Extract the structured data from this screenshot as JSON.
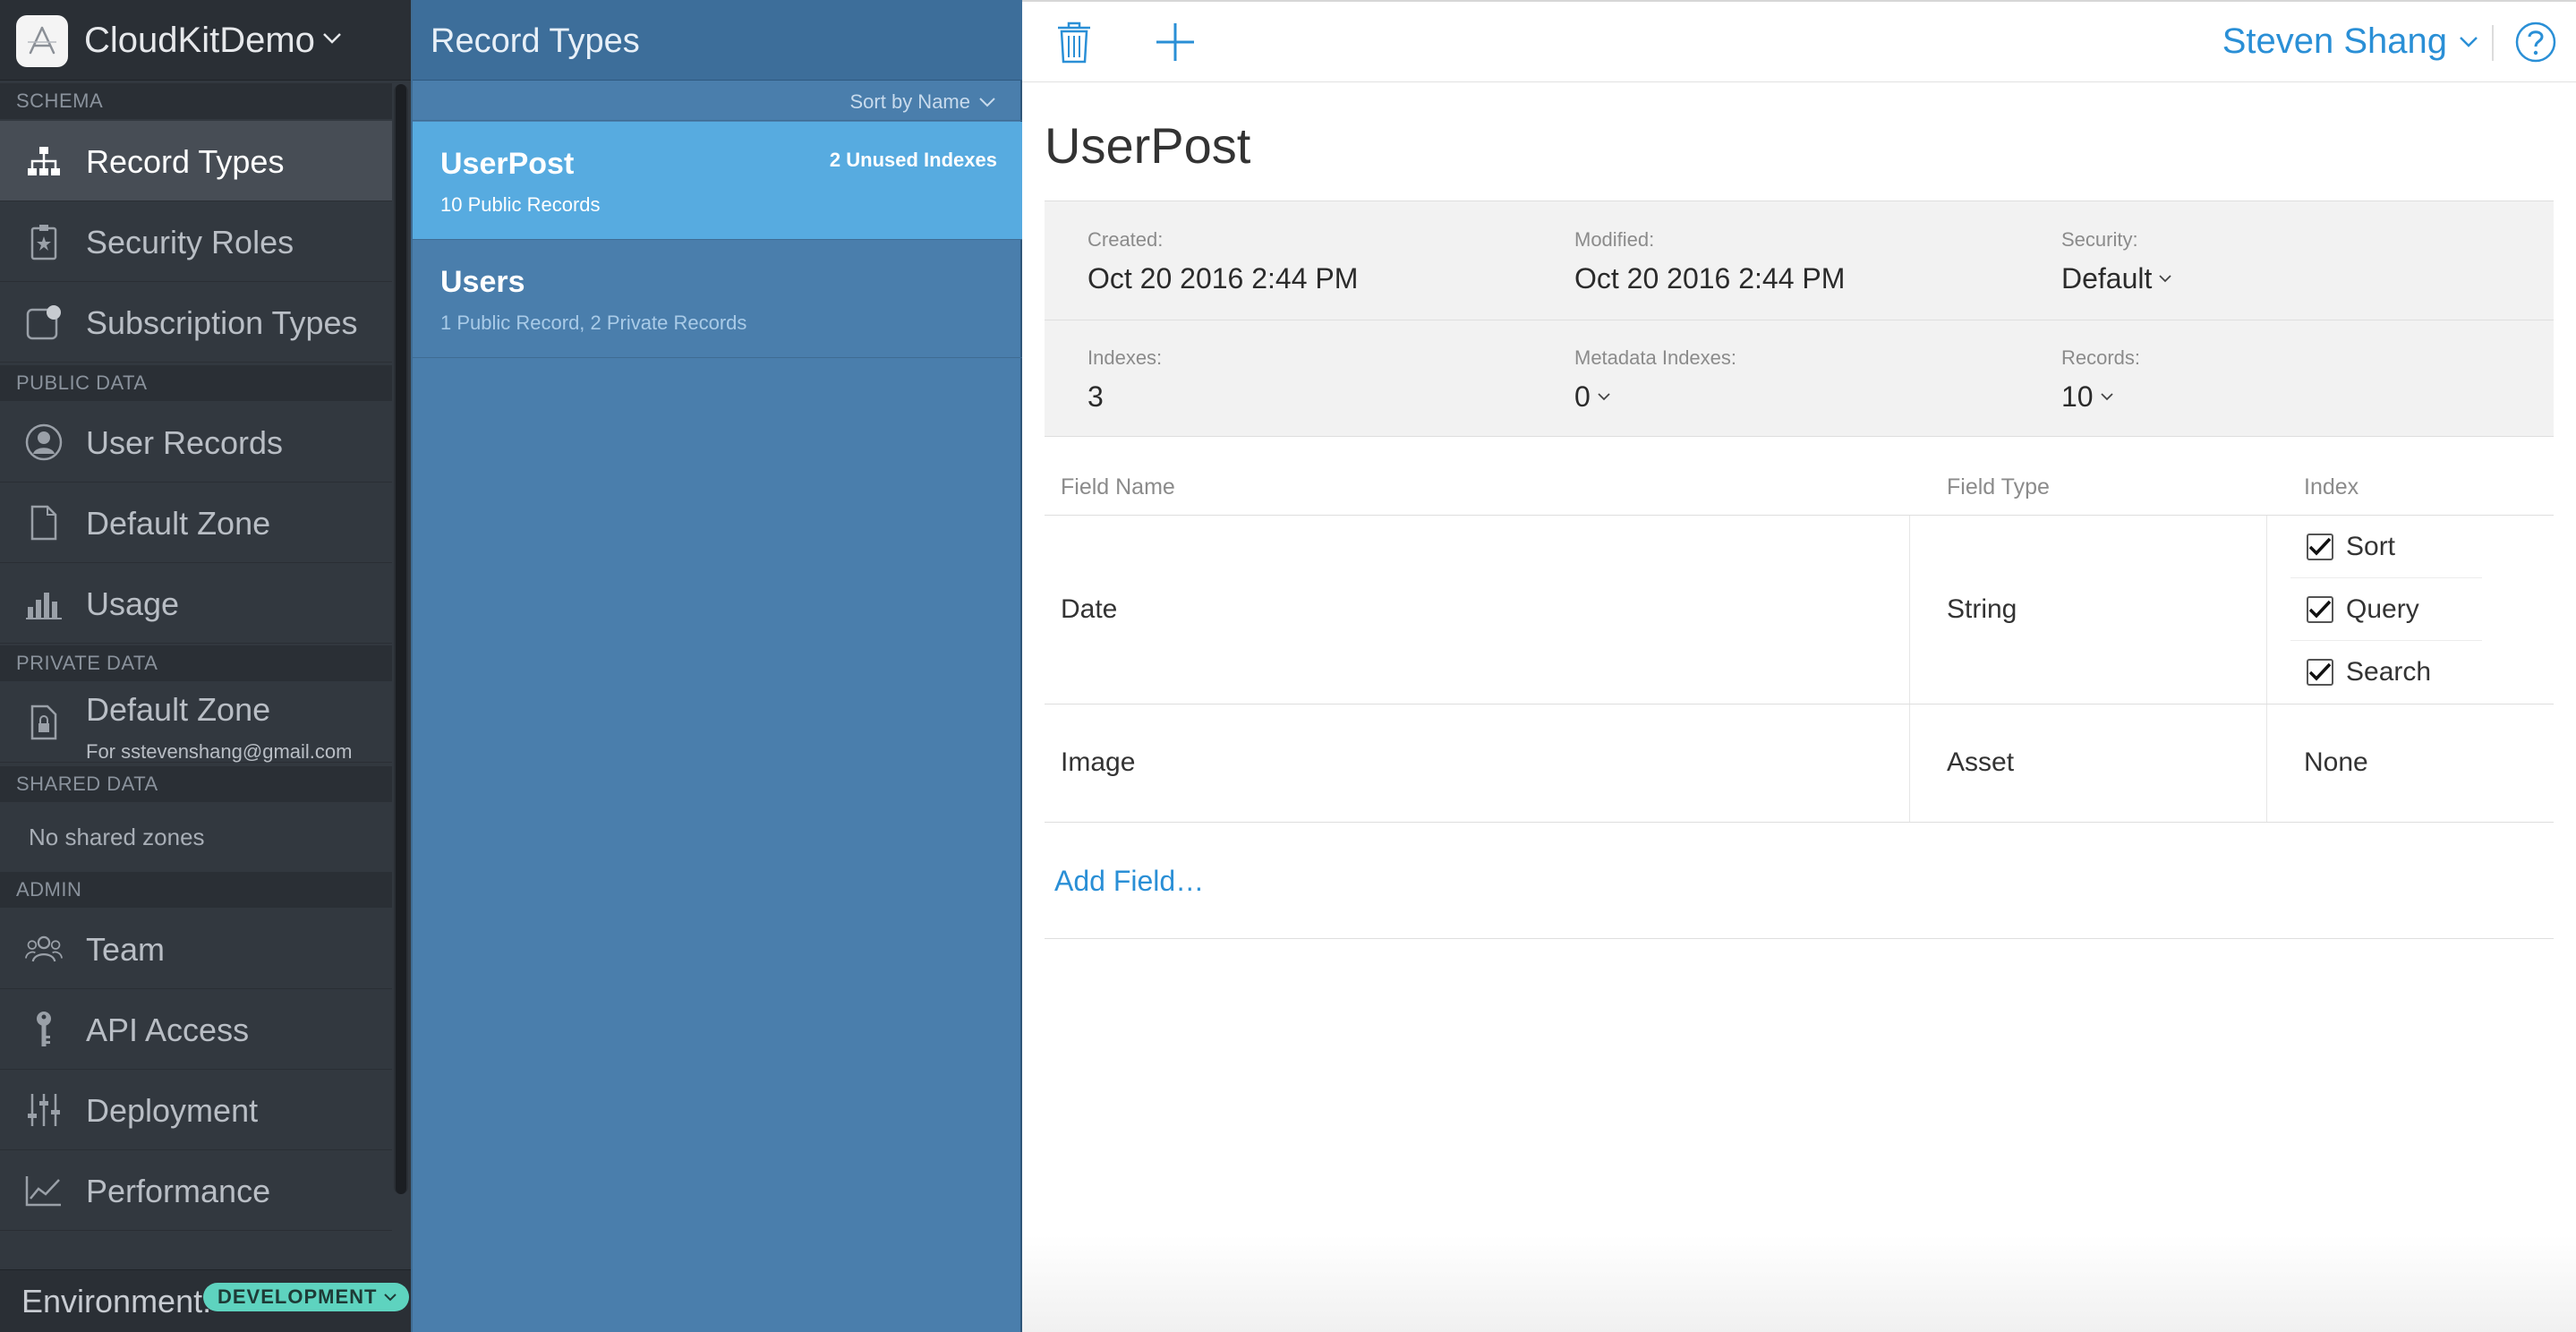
{
  "app": {
    "name": "CloudKitDemo"
  },
  "sidebar": {
    "sections": {
      "schema": "SCHEMA",
      "public_data": "PUBLIC DATA",
      "private_data": "PRIVATE DATA",
      "shared_data": "SHARED DATA",
      "admin": "ADMIN"
    },
    "items": {
      "record_types": {
        "label": "Record Types",
        "icon": "sitemap-icon"
      },
      "security_roles": {
        "label": "Security Roles",
        "icon": "badge-star-icon"
      },
      "subscription_types": {
        "label": "Subscription Types",
        "icon": "subscription-icon"
      },
      "user_records": {
        "label": "User Records",
        "icon": "user-icon"
      },
      "default_zone_public": {
        "label": "Default Zone",
        "icon": "document-icon"
      },
      "usage": {
        "label": "Usage",
        "icon": "bar-chart-icon"
      },
      "default_zone_private": {
        "label": "Default Zone",
        "sublabel": "For sstevenshang@gmail.com",
        "icon": "lock-document-icon"
      },
      "team": {
        "label": "Team",
        "icon": "team-icon"
      },
      "api_access": {
        "label": "API Access",
        "icon": "key-icon"
      },
      "deployment": {
        "label": "Deployment",
        "icon": "sliders-icon"
      },
      "performance": {
        "label": "Performance",
        "icon": "line-chart-icon"
      }
    },
    "no_shared_zones": "No shared zones",
    "environment": {
      "label": "Environment:",
      "value": "DEVELOPMENT"
    }
  },
  "record_types_panel": {
    "title": "Record Types",
    "sort_label": "Sort by Name",
    "types": [
      {
        "name": "UserPost",
        "subtitle": "10 Public Records",
        "badge": "2 Unused Indexes",
        "selected": true
      },
      {
        "name": "Users",
        "subtitle": "1 Public Record, 2 Private Records",
        "badge": "",
        "selected": false
      }
    ]
  },
  "toolbar": {
    "user_name": "Steven Shang",
    "help_icon": "help-icon",
    "delete_icon": "trash-icon",
    "add_icon": "plus-icon"
  },
  "record": {
    "title": "UserPost",
    "meta": {
      "created": {
        "label": "Created:",
        "value": "Oct 20 2016 2:44 PM"
      },
      "modified": {
        "label": "Modified:",
        "value": "Oct 20 2016 2:44 PM"
      },
      "security": {
        "label": "Security:",
        "value": "Default"
      },
      "indexes": {
        "label": "Indexes:",
        "value": "3"
      },
      "metadata_indexes": {
        "label": "Metadata Indexes:",
        "value": "0"
      },
      "records": {
        "label": "Records:",
        "value": "10"
      }
    },
    "fields_table": {
      "headers": {
        "name": "Field Name",
        "type": "Field Type",
        "index": "Index"
      },
      "rows": [
        {
          "name": "Date",
          "type": "String",
          "index_options": [
            {
              "label": "Sort",
              "checked": true
            },
            {
              "label": "Query",
              "checked": true
            },
            {
              "label": "Search",
              "checked": true
            }
          ]
        },
        {
          "name": "Image",
          "type": "Asset",
          "index_text": "None"
        }
      ],
      "add_field_label": "Add Field…"
    }
  },
  "colors": {
    "sidebar_bg": "#32383f",
    "panel_blue": "#4a7eac",
    "selected_blue": "#57abe0",
    "link_blue": "#2a8fd6",
    "env_badge": "#5ed3bf"
  }
}
